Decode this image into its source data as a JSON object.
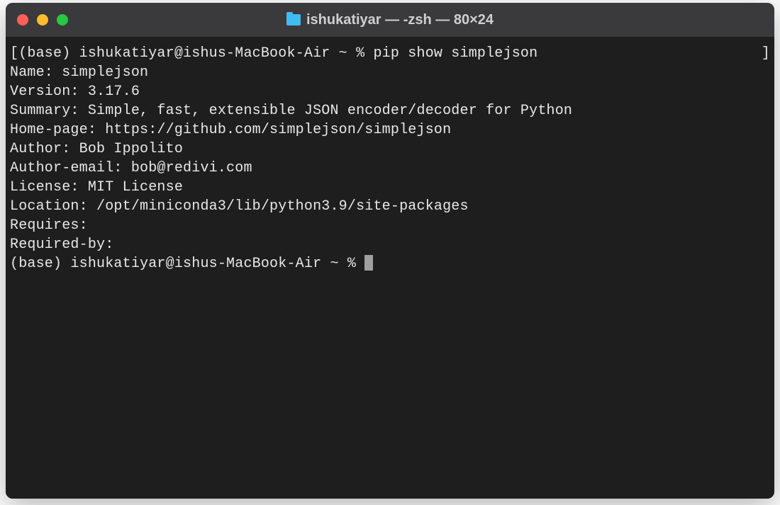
{
  "window": {
    "title": "ishukatiyar — -zsh — 80×24"
  },
  "terminal": {
    "prompt_open": "[",
    "prompt_close": "]",
    "prompt1_prefix": "(base) ishukatiyar@ishus-MacBook-Air ~ % ",
    "command1": "pip show simplejson",
    "output": {
      "name_line": "Name: simplejson",
      "version_line": "Version: 3.17.6",
      "summary_line": "Summary: Simple, fast, extensible JSON encoder/decoder for Python",
      "homepage_line": "Home-page: https://github.com/simplejson/simplejson",
      "author_line": "Author: Bob Ippolito",
      "author_email_line": "Author-email: bob@redivi.com",
      "license_line": "License: MIT License",
      "location_line": "Location: /opt/miniconda3/lib/python3.9/site-packages",
      "requires_line": "Requires:",
      "required_by_line": "Required-by:"
    },
    "prompt2": "(base) ishukatiyar@ishus-MacBook-Air ~ % "
  }
}
